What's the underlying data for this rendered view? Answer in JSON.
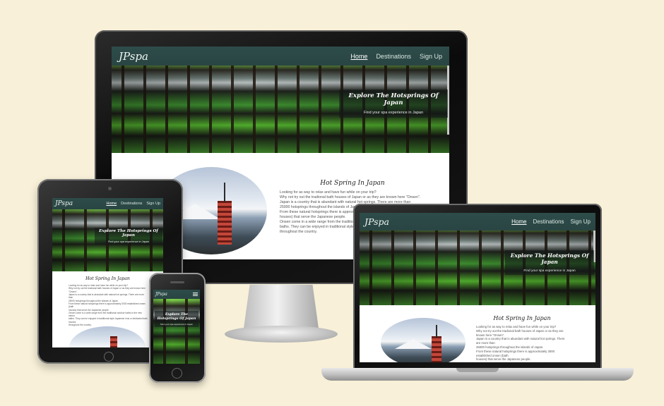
{
  "site": {
    "logo": "JPspa",
    "nav": [
      {
        "label": "Home",
        "active": true
      },
      {
        "label": "Destinations",
        "active": false
      },
      {
        "label": "Sign Up",
        "active": false
      }
    ],
    "hero_title": "Explore The Hotsprings Of Japan",
    "hero_subtitle": "Find your spa experience in Japan",
    "section_title": "Hot Spring In Japan",
    "paragraphs": [
      "Looking for as way to relax and have fun while on your trip?",
      "Why not try out the tradional bath houses of Japan or as they are known here \"Onsen\".",
      "Japan is a country that is abundant with natural hot springs. There are more than",
      "25000 hotsprings throughout the islands of Japan.",
      "From these natural hotsprings there is approximately 3000 established onsen (bath",
      "houses) that serve the Japanese people.",
      "Onsen come in a wide range from the traditional outdoor baths to the new indoor",
      "baths. They can be enjoyed in traditional style Japanese inns or dedicated bath houses",
      "throughout the country."
    ]
  },
  "colors": {
    "background": "#f8f0d8",
    "nav_bar": "#2d4c4a",
    "accent_text": "#ffffff"
  },
  "icons": {
    "menu": "hamburger-menu-icon"
  }
}
